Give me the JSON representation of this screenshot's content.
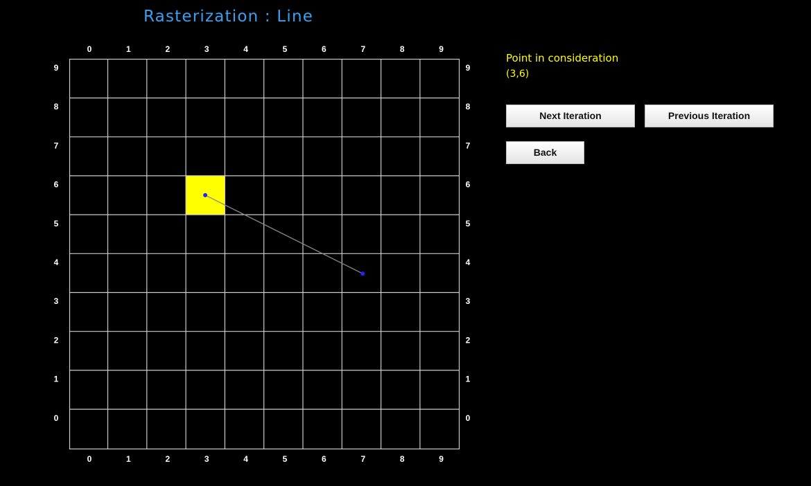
{
  "page": {
    "title": "Rasterization : Line"
  },
  "grid": {
    "columns": [
      "0",
      "1",
      "2",
      "3",
      "4",
      "5",
      "6",
      "7",
      "8",
      "9"
    ],
    "rows": [
      "9",
      "8",
      "7",
      "6",
      "5",
      "4",
      "3",
      "2",
      "1",
      "0"
    ],
    "line_color": "#cccccc",
    "highlighted_cell": {
      "col": 3,
      "row": 6,
      "color": "#ffff00"
    },
    "line_segment": {
      "start": {
        "x": 3,
        "y": 6
      },
      "end": {
        "x": 7,
        "y": 4
      },
      "color": "#888888",
      "point_color": "#2222ff"
    }
  },
  "panel": {
    "label": "Point in consideration",
    "value": "(3,6)"
  },
  "buttons": {
    "next": "Next Iteration",
    "previous": "Previous Iteration",
    "back": "Back"
  }
}
